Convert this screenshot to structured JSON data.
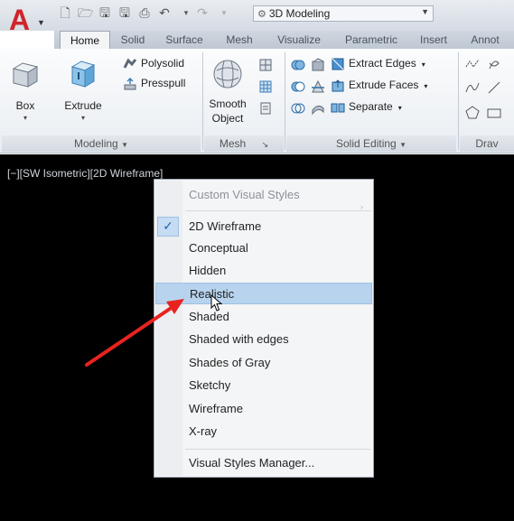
{
  "title_bar": {
    "workspace": "3D Modeling"
  },
  "tabs": [
    "Home",
    "Solid",
    "Surface",
    "Mesh",
    "Visualize",
    "Parametric",
    "Insert",
    "Annot"
  ],
  "ribbon": {
    "modeling": {
      "title": "Modeling",
      "box_label": "Box",
      "extrude_label": "Extrude",
      "polysolid_label": "Polysolid",
      "presspull_label": "Presspull"
    },
    "mesh": {
      "title": "Mesh",
      "smooth_label_1": "Smooth",
      "smooth_label_2": "Object"
    },
    "solid_editing": {
      "title": "Solid Editing",
      "extract_edges": "Extract Edges",
      "extrude_faces": "Extrude Faces",
      "separate": "Separate"
    },
    "draw": {
      "title": "Drav"
    }
  },
  "viewport": {
    "label_prefix": "[−][SW Isometric][",
    "label_style": "2D Wireframe",
    "label_suffix": "]"
  },
  "context_menu": {
    "header": "Custom Visual Styles",
    "items": [
      "2D Wireframe",
      "Conceptual",
      "Hidden",
      "Realistic",
      "Shaded",
      "Shaded with edges",
      "Shades of Gray",
      "Sketchy",
      "Wireframe",
      "X-ray"
    ],
    "checked_item": "2D Wireframe",
    "hovered_item": "Realistic",
    "footer": "Visual Styles Manager..."
  },
  "colors": {
    "app_red": "#d0242b",
    "annotation_arrow": "#e8231f",
    "hover_bg": "#b7d3ee",
    "viewport_bg": "#000000"
  }
}
